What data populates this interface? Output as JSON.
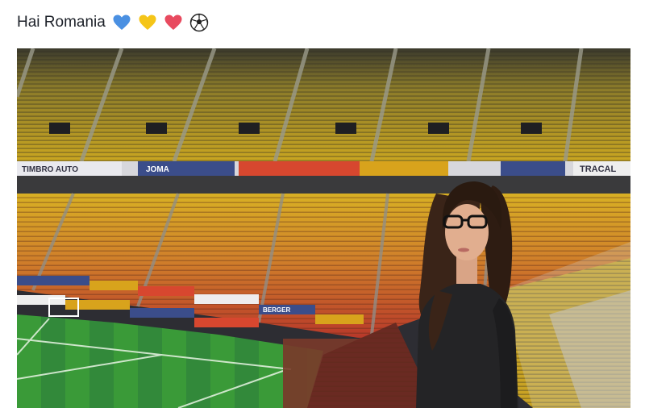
{
  "post": {
    "caption": "Hai Romania",
    "emojis": [
      "blue-heart-icon",
      "yellow-heart-icon",
      "red-heart-icon",
      "soccer-ball-icon"
    ]
  },
  "colors": {
    "seat_yellow": "#e6c21a",
    "seat_red": "#c8402a",
    "pitch_green": "#3f9b3a",
    "blue_heart": "#4a90e2",
    "yellow_heart": "#f5c518",
    "red_heart": "#e84a5f"
  },
  "ads": {
    "upper_ring_left": "TIMBRO AUTO",
    "upper_ring_mid": "JOMA",
    "upper_ring_right": "TRACAL",
    "pitch_side": "BERGER"
  }
}
